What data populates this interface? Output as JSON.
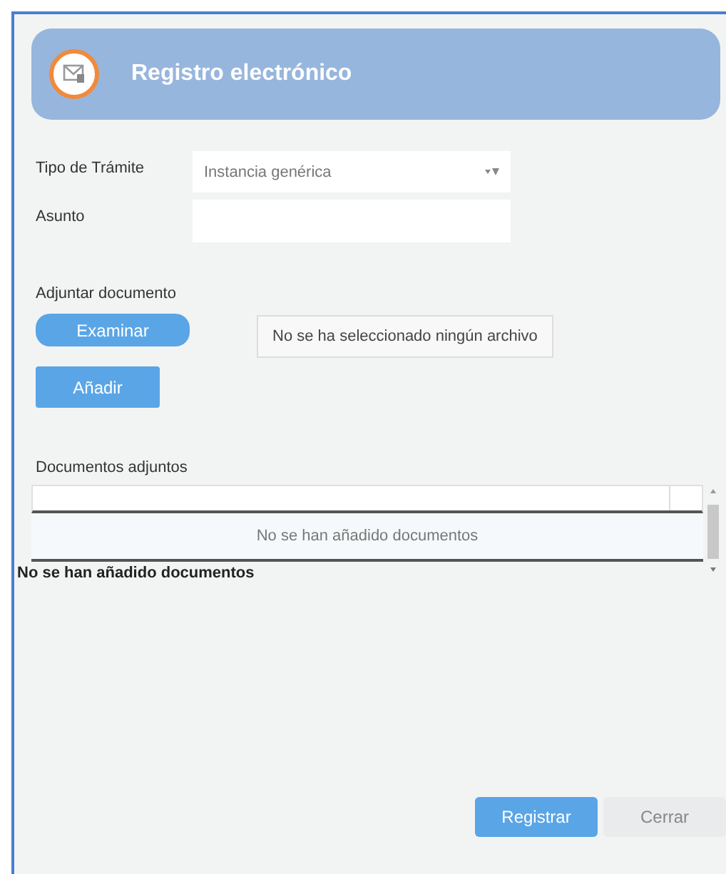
{
  "header": {
    "title": "Registro electrónico"
  },
  "form": {
    "fields": [
      {
        "kind": "select",
        "label": "Tipo de Trámite",
        "value": "Instancia genérica"
      },
      {
        "kind": "text",
        "label": "Asunto"
      }
    ]
  },
  "attach": {
    "label": "Adjuntar documento",
    "browse_button": "Examinar",
    "file_status": "No se ha seleccionado ningún archivo",
    "add_button": "Añadir"
  },
  "documents": {
    "label": "Documentos adjuntos",
    "empty_message": "No se han añadido documentos",
    "footer": "No se han añadido documentos"
  },
  "buttons": [
    {
      "label": "Registrar",
      "kind": "primary"
    },
    {
      "label": "Cerrar",
      "kind": "secondary"
    }
  ]
}
